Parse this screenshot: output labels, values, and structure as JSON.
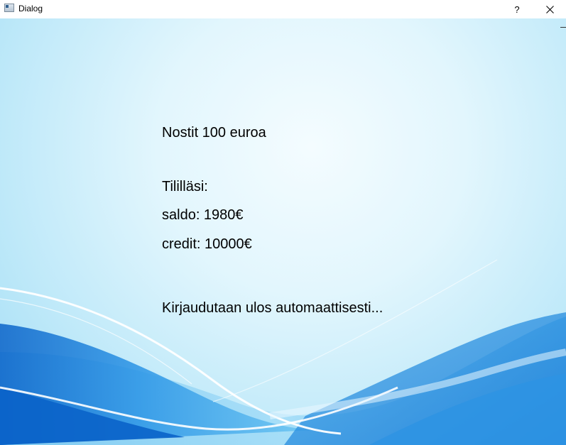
{
  "window": {
    "title": "Dialog",
    "help_label": "?",
    "close_icon": "close-icon"
  },
  "message": {
    "withdrawal": "Nostit 100 euroa",
    "account_heading": "Tililläsi:",
    "balance": "saldo: 1980€",
    "credit": "credit: 10000€",
    "logout_notice": "Kirjaudutaan ulos automaattisesti..."
  },
  "colors": {
    "background_light": "#e2f6fd",
    "wave_blue": "#1f8de0",
    "wave_deep": "#0a63c9"
  }
}
